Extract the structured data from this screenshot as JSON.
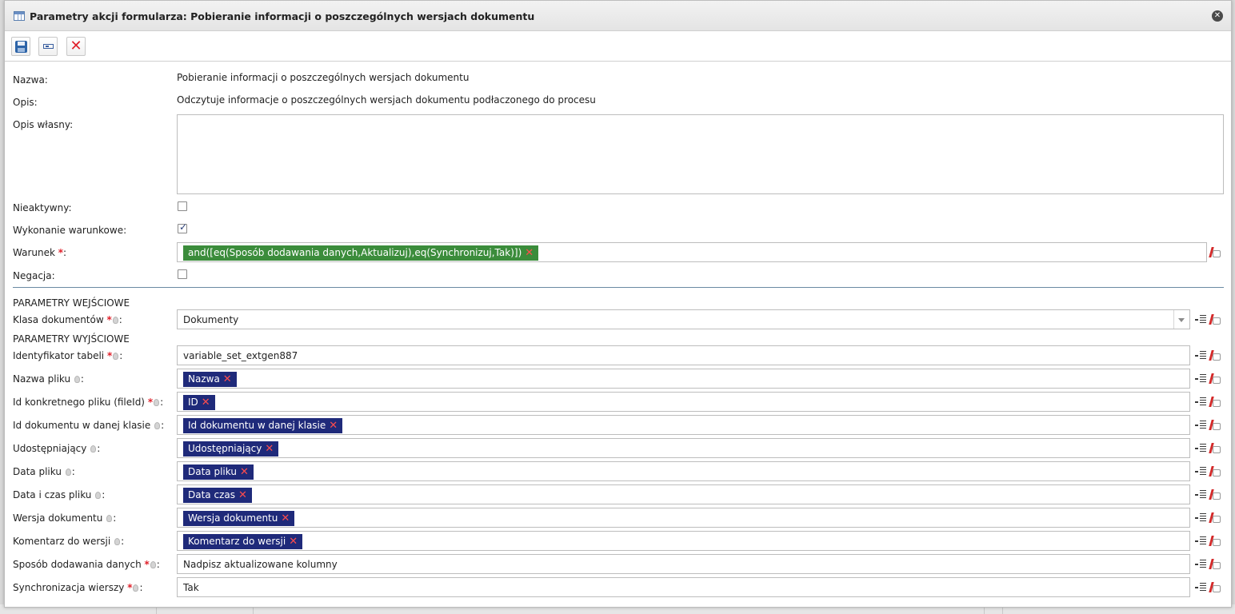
{
  "dialog": {
    "title": "Parametry akcji formularza: Pobieranie informacji o poszczególnych wersjach dokumentu"
  },
  "toolbar": {
    "save_icon": "floppy-disk-icon",
    "label_icon": "label-icon",
    "cancel_icon": "red-x-icon"
  },
  "form": {
    "nazwa_label": "Nazwa:",
    "nazwa_value": "Pobieranie informacji o poszczególnych wersjach dokumentu",
    "opis_label": "Opis:",
    "opis_value": "Odczytuje informacje o poszczególnych wersjach dokumentu podłaczonego do procesu",
    "opis_wlasny_label": "Opis własny:",
    "opis_wlasny_value": "",
    "nieaktywny_label": "Nieaktywny:",
    "nieaktywny_checked": false,
    "wykonanie_label": "Wykonanie warunkowe:",
    "wykonanie_checked": true,
    "warunek_label": "Warunek",
    "warunek_value": "and([eq(Sposób dodawania danych,Aktualizuj),eq(Synchronizuj,Tak)])",
    "negacja_label": "Negacja:",
    "negacja_checked": false
  },
  "input_section": {
    "heading": "PARAMETRY WEJŚCIOWE",
    "klasa_label": "Klasa dokumentów",
    "klasa_value": "Dokumenty"
  },
  "output_section": {
    "heading": "PARAMETRY WYJŚCIOWE",
    "rows": [
      {
        "label": "Identyfikator tabeli",
        "required": true,
        "value": "variable_set_extgen887",
        "tag": false
      },
      {
        "label": "Nazwa pliku",
        "required": false,
        "value": "Nazwa",
        "tag": true
      },
      {
        "label": "Id konkretnego pliku (fileId)",
        "required": true,
        "value": "ID",
        "tag": true
      },
      {
        "label": "Id dokumentu w danej klasie",
        "required": false,
        "value": "Id dokumentu w danej klasie",
        "tag": true
      },
      {
        "label": "Udostępniający",
        "required": false,
        "value": "Udostępniający",
        "tag": true
      },
      {
        "label": "Data pliku",
        "required": false,
        "value": "Data pliku",
        "tag": true
      },
      {
        "label": "Data i czas pliku",
        "required": false,
        "value": "Data czas",
        "tag": true
      },
      {
        "label": "Wersja dokumentu",
        "required": false,
        "value": "Wersja dokumentu",
        "tag": true
      },
      {
        "label": "Komentarz do wersji",
        "required": false,
        "value": "Komentarz do wersji",
        "tag": true
      },
      {
        "label": "Sposób dodawania danych",
        "required": true,
        "value": "Nadpisz aktualizowane kolumny",
        "tag": false
      },
      {
        "label": "Synchronizacja wierszy",
        "required": true,
        "value": "Tak",
        "tag": false
      }
    ]
  },
  "colors": {
    "tag_navy": "#1f2a7a",
    "tag_green": "#3b8c3b",
    "required_red": "#e0202a"
  }
}
